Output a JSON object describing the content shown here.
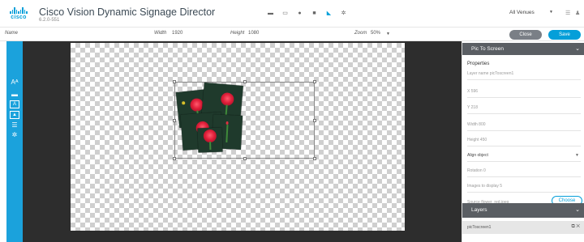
{
  "header": {
    "brand_word": "cisco",
    "app_title": "Cisco Vision Dynamic Signage Director",
    "version": "6.2.0-551",
    "toolbar_icons": [
      "folder-icon",
      "monitor-icon",
      "globe-icon",
      "grid-icon",
      "flag-icon",
      "gear-icon"
    ],
    "venue_select": "All Venues",
    "menu_icon": "list-icon",
    "user_icon": "user-icon"
  },
  "propbar": {
    "name_label": "Name",
    "width_label": "Width",
    "width_value": "1920",
    "height_label": "Height",
    "height_value": "1080",
    "zoom_label": "Zoom",
    "zoom_value": "50%",
    "close_label": "Close",
    "save_label": "Save"
  },
  "rail": {
    "icons": [
      "text-icon",
      "line-icon",
      "text-box-icon",
      "image-icon",
      "list-icon",
      "gear-icon"
    ]
  },
  "panel": {
    "title": "Pic To Screen",
    "properties_title": "Properties",
    "layer_name": "Layer name  picToscreen1",
    "x": "X  596",
    "y": "Y  218",
    "width": "Width  800",
    "height": "Height  450",
    "align": "Align object",
    "rotation": "Rotation  0",
    "images": "Images to display  5",
    "source": "Source  flower_red.jpeg",
    "choose_label": "Choose",
    "layers_title": "Layers",
    "layer_item": "picToscreen1"
  },
  "colors": {
    "accent": "#049fd9",
    "rail": "#1ba2dc",
    "panel_head": "#5a5e63",
    "stage": "#2d2d2d"
  }
}
